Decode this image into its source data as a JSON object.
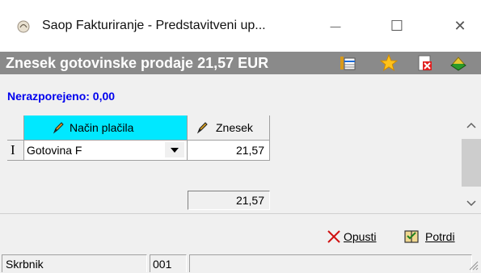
{
  "window": {
    "title": "Saop Fakturiranje - Predstavitveni up...",
    "minimize": "—",
    "maximize": "☐",
    "close": "✕"
  },
  "header": {
    "title": "Znesek gotovinske prodaje 21,57  EUR",
    "icons": [
      "list-table-icon",
      "star-icon",
      "delete-document-icon",
      "book-icon"
    ]
  },
  "unallocated_label": "Nerazporejeno: 0,00",
  "grid": {
    "columns": [
      {
        "label": "Način plačila"
      },
      {
        "label": "Znesek"
      }
    ],
    "rows": [
      {
        "marker": "I",
        "method": "Gotovina F",
        "amount": "21,57"
      }
    ],
    "total": "21,57"
  },
  "actions": {
    "cancel": "Opusti",
    "confirm": "Potrdi"
  },
  "status": {
    "user": "Skrbnik",
    "code": "001",
    "extra": ""
  },
  "colors": {
    "header_bg": "#8a8a8a",
    "active_column": "#00e8ff",
    "unallocated_text": "#0000ee",
    "cancel_icon": "#d01010"
  }
}
